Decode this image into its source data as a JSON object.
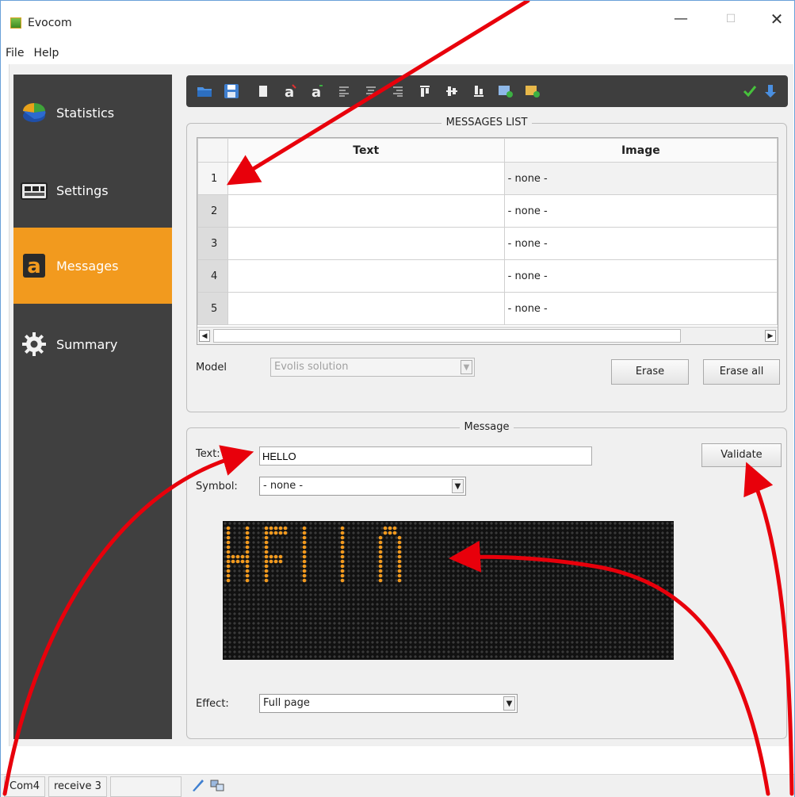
{
  "window": {
    "title": "Evocom",
    "minimize": "—",
    "maximize": "☐",
    "close": "✕"
  },
  "menu": [
    {
      "label": "File"
    },
    {
      "label": "Help"
    }
  ],
  "sidebar": {
    "items": [
      {
        "label": "Statistics",
        "icon": "pie-chart-icon",
        "active": false
      },
      {
        "label": "Settings",
        "icon": "device-icon",
        "active": false
      },
      {
        "label": "Messages",
        "icon": "letter-a-icon",
        "active": true
      },
      {
        "label": "Summary",
        "icon": "gear-icon",
        "active": false
      }
    ]
  },
  "toolbar": {
    "buttons": [
      "folder-open-icon",
      "save-icon",
      "block-icon",
      "font-bold-icon",
      "font-small-icon",
      "align-left-icon",
      "align-center-icon",
      "align-right-icon",
      "align-top-icon",
      "align-middle-icon",
      "align-bottom-icon",
      "add-image-icon",
      "add-symbol-icon"
    ],
    "right_buttons": [
      "checkmark-icon",
      "send-icon"
    ]
  },
  "messages_list": {
    "title": "MESSAGES LIST",
    "columns": [
      "Text",
      "Image"
    ],
    "rows": [
      {
        "num": "1",
        "text": "",
        "image": "- none -"
      },
      {
        "num": "2",
        "text": "",
        "image": "- none -"
      },
      {
        "num": "3",
        "text": "",
        "image": "- none -"
      },
      {
        "num": "4",
        "text": "",
        "image": "- none -"
      },
      {
        "num": "5",
        "text": "",
        "image": "- none -"
      }
    ],
    "model_label": "Model",
    "model_value": "Evolis solution",
    "erase_label": "Erase",
    "erase_all_label": "Erase all"
  },
  "message": {
    "title": "Message",
    "text_label": "Text:",
    "text_value": "HELLO",
    "symbol_label": "Symbol:",
    "symbol_value": "- none -",
    "validate_label": "Validate",
    "effect_label": "Effect:",
    "effect_value": "Full page",
    "preview_text": "HELLO",
    "led_color": "#f29a1e"
  },
  "statusbar": {
    "port": "Com4",
    "receive": "receive 3"
  },
  "colors": {
    "accent": "#f29a1e",
    "sidebar_bg": "#404040",
    "annotation": "#e8000b"
  }
}
